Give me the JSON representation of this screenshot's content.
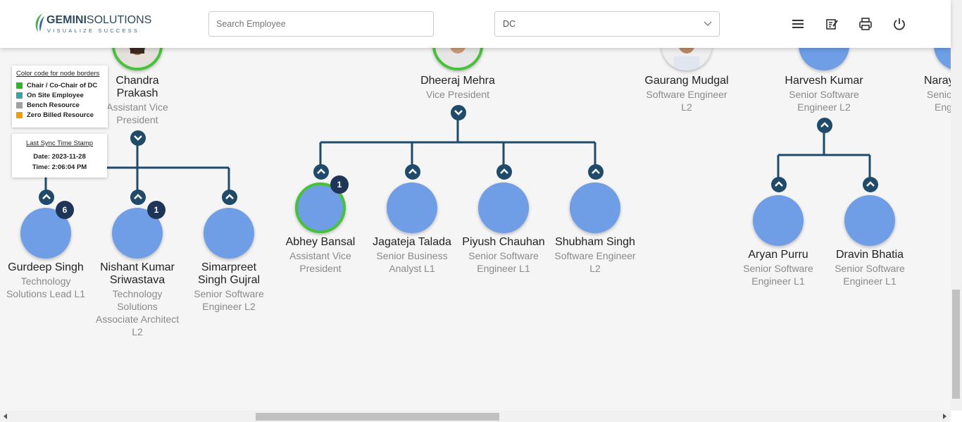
{
  "header": {
    "logo_name": "GEMINI",
    "logo_suffix": "SOLUTIONS",
    "logo_tagline": "VISUALIZE SUCCESS",
    "search_placeholder": "Search Employee",
    "department": "DC",
    "icons": [
      "menu-icon",
      "edit-note-icon",
      "print-icon",
      "power-icon"
    ]
  },
  "legend": {
    "heading": "Color code for node borders",
    "items": [
      {
        "label": "Chair / Co-Chair of DC",
        "color": "#2fb52a"
      },
      {
        "label": "On Site Employee",
        "color": "#3aa3a3"
      },
      {
        "label": "Bench Resource",
        "color": "#a0a0a0"
      },
      {
        "label": "Zero Billed Resource",
        "color": "#f0a000"
      }
    ]
  },
  "sync": {
    "heading": "Last Sync Time Stamp",
    "date": "Date: 2023-11-28",
    "time": "Time: 2:06:04 PM"
  },
  "nodes": {
    "chandra": {
      "name1": "Chandra",
      "name2": "Prakash",
      "title1": "Assistant Vice",
      "title2": "President"
    },
    "dheeraj": {
      "name": "Dheeraj Mehra",
      "title": "Vice President"
    },
    "gaurang": {
      "name": "Gaurang Mudgal",
      "title1": "Software Engineer",
      "title2": "L2"
    },
    "harvesh": {
      "name": "Harvesh Kumar",
      "title1": "Senior Software",
      "title2": "Engineer L2"
    },
    "naray": {
      "name": "Naray",
      "title1": "Senio",
      "title2": "Eng"
    },
    "gurdeep": {
      "name": "Gurdeep Singh",
      "title1": "Technology",
      "title2": "Solutions Lead L1",
      "badge": "6"
    },
    "nishant": {
      "name1": "Nishant Kumar",
      "name2": "Sriwastava",
      "title1": "Technology",
      "title2": "Solutions",
      "title3": "Associate Architect",
      "title4": "L2",
      "badge": "1"
    },
    "simarpreet": {
      "name1": "Simarpreet",
      "name2": "Singh Gujral",
      "title1": "Senior Software",
      "title2": "Engineer L2"
    },
    "abhey": {
      "name": "Abhey Bansal",
      "title1": "Assistant Vice",
      "title2": "President",
      "badge": "1"
    },
    "jagateja": {
      "name": "Jagateja Talada",
      "title1": "Senior Business",
      "title2": "Analyst L1"
    },
    "piyush": {
      "name": "Piyush Chauhan",
      "title1": "Senior Software",
      "title2": "Engineer L1"
    },
    "shubham": {
      "name": "Shubham Singh",
      "title1": "Software Engineer",
      "title2": "L2"
    },
    "aryan": {
      "name": "Aryan Purru",
      "title1": "Senior Software",
      "title2": "Engineer L1"
    },
    "dravin": {
      "name": "Dravin Bhatia",
      "title1": "Senior Software",
      "title2": "Engineer L1"
    }
  }
}
